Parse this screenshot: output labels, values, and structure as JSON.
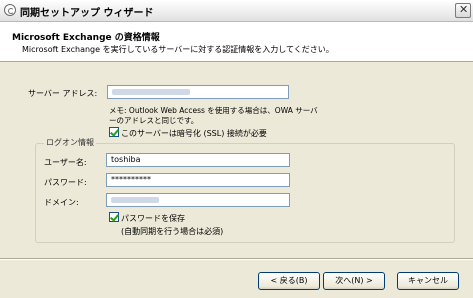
{
  "window": {
    "title": "同期セットアップ ウィザード"
  },
  "header": {
    "title": "Microsoft Exchange の資格情報",
    "subtitle": "Microsoft Exchange を実行しているサーバーに対する認証情報を入力してください。"
  },
  "server": {
    "label": "サーバー アドレス:",
    "note_line1": "メモ: Outlook Web Access を使用する場合は、OWA サーバ",
    "note_line2": "ーのアドレスと同じです。",
    "ssl_checkbox_label": "このサーバーは暗号化 (SSL) 接続が必要",
    "ssl_checked": true
  },
  "logon": {
    "group_label": "ログオン情報",
    "username_label": "ユーザー名:",
    "username_value": "toshiba",
    "password_label": "パスワード:",
    "password_value": "**********",
    "domain_label": "ドメイン:",
    "save_password_label": "パスワードを保存",
    "save_password_note": "(自動同期を行う場合は必須)",
    "save_password_checked": true
  },
  "buttons": {
    "back": "< 戻る(B)",
    "next": "次へ(N) >",
    "cancel": "キャンセル"
  }
}
